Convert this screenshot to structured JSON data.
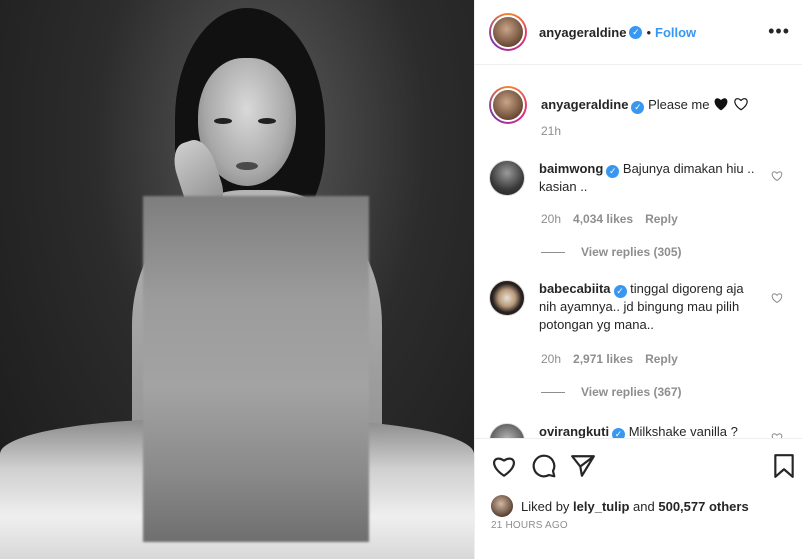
{
  "post": {
    "author": "anyageraldine",
    "follow_label": "Follow",
    "dot": "•",
    "more_label": "•••"
  },
  "caption": {
    "author": "anyageraldine",
    "text": "Please me",
    "time": "21h"
  },
  "comments": [
    {
      "author": "baimwong",
      "text": "Bajunya dimakan hiu .. kasian ..",
      "time": "20h",
      "likes": "4,034 likes",
      "reply": "Reply",
      "view_replies": "View replies (305)"
    },
    {
      "author": "babecabiita",
      "text": "tinggal digoreng aja nih ayamnya.. jd bingung mau pilih potongan yg mana..",
      "time": "20h",
      "likes": "2,971 likes",
      "reply": "Reply",
      "view_replies": "View replies (367)"
    },
    {
      "author": "ovirangkuti",
      "text": "Milkshake vanilla ?"
    }
  ],
  "likes_summary": {
    "prefix": "Liked by",
    "user": "lely_tulip",
    "middle": "and",
    "count": "500,577 others"
  },
  "timestamp": "21 HOURS AGO",
  "colors": {
    "accent": "#3897f0",
    "muted": "#8e8e8e",
    "text": "#262626"
  },
  "icons": [
    "verified-badge-icon",
    "more-options-icon",
    "heart-outline-icon",
    "comment-icon",
    "share-icon",
    "bookmark-icon",
    "black-heart-emoji",
    "white-heart-emoji"
  ]
}
